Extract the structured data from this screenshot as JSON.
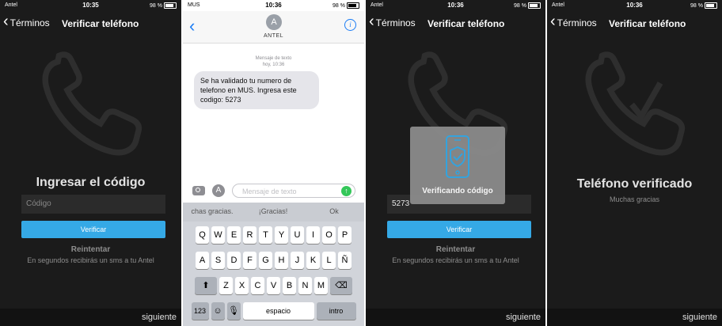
{
  "colors": {
    "accent": "#35a9e6",
    "dark_bg": "#1b1b1b",
    "sms_bubble": "#e5e5ea",
    "send_green": "#34c759",
    "ios_blue": "#1a7cf5"
  },
  "screen1": {
    "status": {
      "carrier": "Antel",
      "time": "10:35",
      "battery": "98 %"
    },
    "nav": {
      "back_label": "Términos",
      "title": "Verificar teléfono"
    },
    "heading": "Ingresar el código",
    "code_placeholder": "Código",
    "verify_button": "Verificar",
    "resend": "Reintentar",
    "hint": "En segundos recibirás un sms a tu Antel",
    "next": "siguiente"
  },
  "screen2": {
    "status": {
      "carrier": "MUS",
      "time": "10:36",
      "battery": "98 %"
    },
    "contact_initial": "A",
    "contact_name": "ANTEL",
    "message_meta": {
      "type": "Mensaje de texto",
      "time": "hoy, 10:36"
    },
    "message": "Se ha validado tu numero de telefono en MUS. Ingresa este codigo: 5273",
    "input_placeholder": "Mensaje de texto",
    "predictions": [
      "chas gracias.",
      "¡Gracias!",
      "Ok"
    ],
    "keys_row1": [
      "Q",
      "W",
      "E",
      "R",
      "T",
      "Y",
      "U",
      "I",
      "O",
      "P"
    ],
    "keys_row2": [
      "A",
      "S",
      "D",
      "F",
      "G",
      "H",
      "J",
      "K",
      "L",
      "Ñ"
    ],
    "keys_row3": [
      "Z",
      "X",
      "C",
      "V",
      "B",
      "N",
      "M"
    ],
    "key_123": "123",
    "key_space": "espacio",
    "key_intro": "intro"
  },
  "screen3": {
    "status": {
      "carrier": "Antel",
      "time": "10:36",
      "battery": "98 %"
    },
    "nav": {
      "back_label": "Términos",
      "title": "Verificar teléfono"
    },
    "code_value": "5273",
    "verify_button": "Verificar",
    "resend": "Reintentar",
    "hint": "En segundos recibirás un sms a tu Antel",
    "overlay_text": "Verificando código",
    "next": "siguiente"
  },
  "screen4": {
    "status": {
      "carrier": "Antel",
      "time": "10:36",
      "battery": "98 %"
    },
    "nav": {
      "back_label": "Términos",
      "title": "Verificar teléfono"
    },
    "heading": "Teléfono verificado",
    "subheading": "Muchas gracias",
    "next": "siguiente"
  }
}
